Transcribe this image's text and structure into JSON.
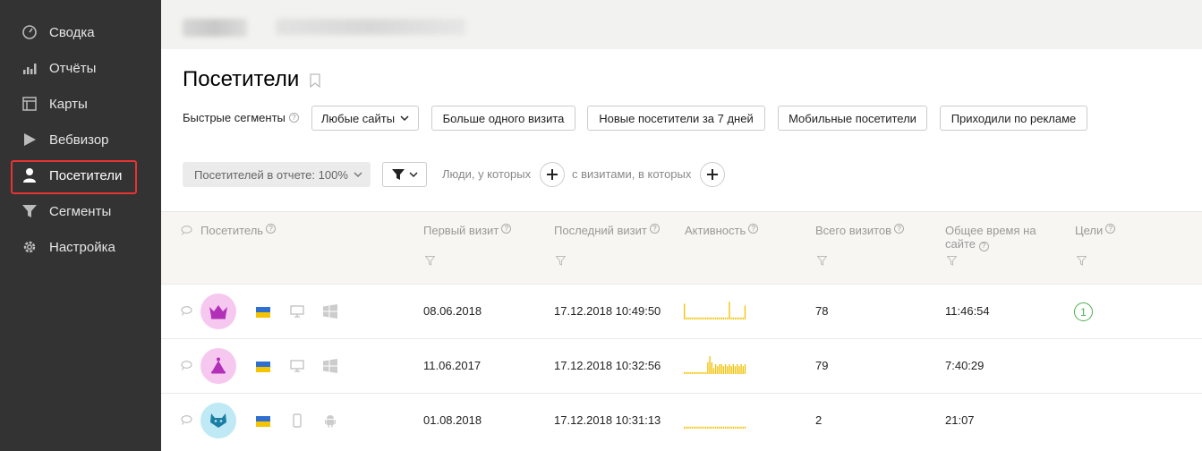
{
  "sidebar": {
    "items": [
      {
        "label": "Сводка",
        "icon": "dashboard-icon"
      },
      {
        "label": "Отчёты",
        "icon": "bar-chart-icon"
      },
      {
        "label": "Карты",
        "icon": "map-icon"
      },
      {
        "label": "Вебвизор",
        "icon": "play-icon"
      },
      {
        "label": "Посетители",
        "icon": "user-icon",
        "active": true
      },
      {
        "label": "Сегменты",
        "icon": "funnel-icon"
      },
      {
        "label": "Настройка",
        "icon": "gear-icon"
      }
    ]
  },
  "page": {
    "title": "Посетители"
  },
  "segments": {
    "label": "Быстрые сегменты",
    "buttons": [
      "Любые сайты",
      "Больше одного визита",
      "Новые посетители за 7 дней",
      "Мобильные посетители",
      "Приходили по рекламе"
    ]
  },
  "filters": {
    "sample_label": "Посетителей в отчете: 100%",
    "people_label": "Люди, у которых",
    "visits_label": "с визитами, в которых"
  },
  "table": {
    "columns": [
      "Посетитель",
      "Первый визит",
      "Последний визит",
      "Активность",
      "Всего визитов",
      "Общее время на сайте",
      "Цели"
    ],
    "rows": [
      {
        "first_visit": "08.06.2018",
        "last_visit": "17.12.2018 10:49:50",
        "total_visits": "78",
        "total_time": "11:46:54",
        "goals": "1",
        "avatar_icon": "crown-icon",
        "device_icon": "desktop-icon",
        "os_icon": "windows-icon",
        "avatar_color": "#f6c8ef",
        "activity": [
          0.8,
          0.1,
          0.1,
          0.1,
          0.1,
          0.1,
          0.1,
          0.1,
          0.1,
          0.1,
          0.1,
          0.1,
          0.1,
          0.1,
          0.1,
          0.1,
          0.1,
          0.1,
          0.1,
          0.1,
          0.1,
          0.1,
          0.1,
          0.9,
          0.1,
          0.1,
          0.1,
          0.1,
          0.1,
          0.1,
          0.1,
          0.7
        ]
      },
      {
        "first_visit": "11.06.2017",
        "last_visit": "17.12.2018 10:32:56",
        "total_visits": "79",
        "total_time": "7:40:29",
        "goals": "",
        "avatar_icon": "cone-icon",
        "device_icon": "desktop-icon",
        "os_icon": "windows-icon",
        "avatar_color": "#f6c8ef",
        "activity": [
          0.1,
          0.1,
          0.1,
          0.1,
          0.1,
          0.1,
          0.1,
          0.1,
          0.1,
          0.1,
          0.1,
          0.1,
          0.6,
          0.9,
          0.6,
          0.3,
          0.5,
          0.4,
          0.5,
          0.5,
          0.4,
          0.5,
          0.4,
          0.5,
          0.4,
          0.5,
          0.4,
          0.5,
          0.4,
          0.5,
          0.4,
          0.5
        ]
      },
      {
        "first_visit": "01.08.2018",
        "last_visit": "17.12.2018 10:31:13",
        "total_visits": "2",
        "total_time": "21:07",
        "goals": "",
        "avatar_icon": "cat-icon",
        "device_icon": "smartphone-icon",
        "os_icon": "android-icon",
        "avatar_color": "#bfe9f5",
        "activity": [
          0.1,
          0.1,
          0.1,
          0.1,
          0.1,
          0.1,
          0.1,
          0.1,
          0.1,
          0.1,
          0.1,
          0.1,
          0.1,
          0.1,
          0.1,
          0.1,
          0.1,
          0.1,
          0.1,
          0.1,
          0.1,
          0.1,
          0.1,
          0.1,
          0.1,
          0.1,
          0.1,
          0.1,
          0.1,
          0.1,
          0.1,
          0.1
        ]
      }
    ]
  },
  "colors": {
    "sidebar_bg": "#333333",
    "active_outline": "#e63333",
    "sparkline": "#f2c100",
    "goal_green": "#4caf50",
    "flag_blue": "#2f6fcf",
    "flag_yellow": "#f4c400"
  }
}
